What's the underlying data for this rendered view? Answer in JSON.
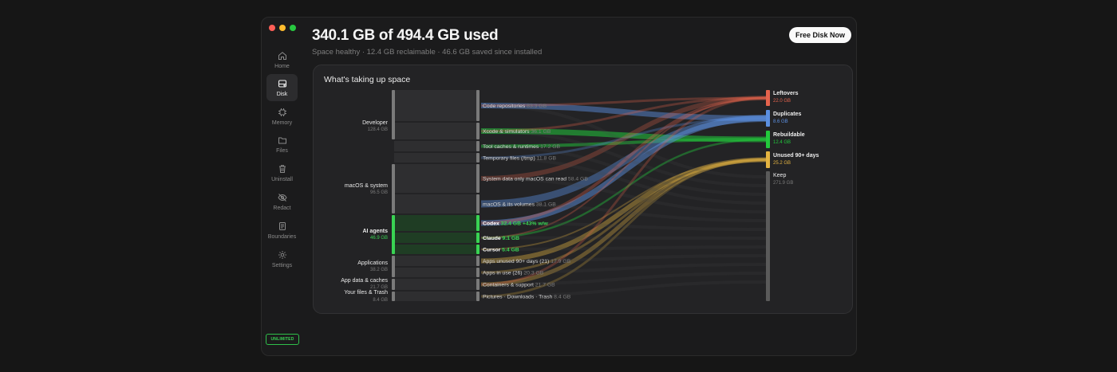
{
  "header": {
    "title": "340.1 GB of 494.4 GB used",
    "subtitle": "Space healthy · 12.4 GB reclaimable · 46.6 GB saved since installed",
    "action_label": "Free Disk Now"
  },
  "sidebar": {
    "items": [
      {
        "label": "Home",
        "icon": "home-icon"
      },
      {
        "label": "Disk",
        "icon": "disk-icon",
        "active": true
      },
      {
        "label": "Memory",
        "icon": "memory-icon"
      },
      {
        "label": "Files",
        "icon": "folder-icon"
      },
      {
        "label": "Uninstall",
        "icon": "trash-icon"
      },
      {
        "label": "Redact",
        "icon": "eye-off-icon"
      },
      {
        "label": "Boundaries",
        "icon": "document-icon"
      },
      {
        "label": "Settings",
        "icon": "gear-icon"
      }
    ],
    "badge": "UNLIMITED"
  },
  "panel": {
    "title": "What's taking up space"
  },
  "colors": {
    "accent_green": "#39d353",
    "leftovers": "#e5634d",
    "duplicates": "#5b8fe0",
    "rebuildable": "#22c83c",
    "unused": "#e3b341",
    "keep": "#5a5a5a"
  },
  "sankey": {
    "sources": [
      {
        "name": "Developer",
        "size": "128.4 GB"
      },
      {
        "name": "macOS & system",
        "size": "96.5 GB"
      },
      {
        "name": "AI agents",
        "size": "46.9 GB",
        "highlight": true
      },
      {
        "name": "Applications",
        "size": "38.2 GB"
      },
      {
        "name": "App data & caches",
        "size": "21.7 GB"
      },
      {
        "name": "Your files & Trash",
        "size": "8.4 GB"
      }
    ],
    "details": [
      {
        "name": "Code repositories",
        "size": "83.3 GB"
      },
      {
        "name": "Xcode & simulators",
        "size": "36.1 GB"
      },
      {
        "name": "Tool caches & runtimes",
        "size": "17.2 GB"
      },
      {
        "name": "Temporary files (/tmp)",
        "size": "11.8 GB"
      },
      {
        "name": "System data only macOS can read",
        "size": "58.4 GB"
      },
      {
        "name": "macOS & its volumes",
        "size": "38.1 GB"
      },
      {
        "name": "Codex",
        "size": "32.4 GB",
        "note": "+43% w/w",
        "highlight": true
      },
      {
        "name": "Claude",
        "size": "9.1 GB",
        "highlight": true
      },
      {
        "name": "Cursor",
        "size": "5.4 GB",
        "highlight": true
      },
      {
        "name": "Apps unused 90+ days (21)",
        "size": "17.9 GB"
      },
      {
        "name": "Apps in use (26)",
        "size": "20.3 GB"
      },
      {
        "name": "Containers & support",
        "size": "21.7 GB"
      },
      {
        "name": "Pictures · Downloads · Trash",
        "size": "8.4 GB"
      }
    ],
    "outcomes": [
      {
        "name": "Leftovers",
        "size": "22.0 GB"
      },
      {
        "name": "Duplicates",
        "size": "8.6 GB"
      },
      {
        "name": "Rebuildable",
        "size": "12.4 GB"
      },
      {
        "name": "Unused 90+ days",
        "size": "25.2 GB"
      },
      {
        "name": "Keep",
        "size": "271.9 GB"
      }
    ]
  }
}
